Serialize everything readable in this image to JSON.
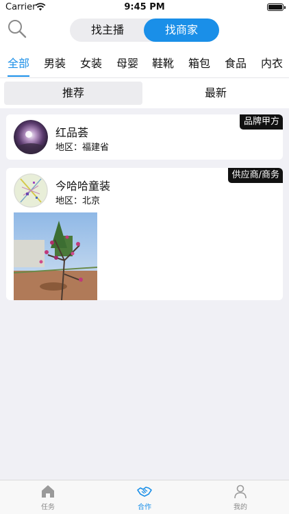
{
  "status_bar": {
    "carrier": "Carrier",
    "time": "9:45 PM"
  },
  "header": {
    "search_icon": "search-icon",
    "toggle": {
      "option_a": "找主播",
      "option_b": "找商家",
      "selected": "找商家"
    }
  },
  "categories": {
    "items": [
      "全部",
      "男装",
      "女装",
      "母婴",
      "鞋靴",
      "箱包",
      "食品",
      "内衣"
    ],
    "active": "全部"
  },
  "sort": {
    "options": [
      "推荐",
      "最新"
    ],
    "selected": "推荐"
  },
  "merchants": [
    {
      "name": "红品荟",
      "region": "地区：福建省",
      "tag": "品牌甲方"
    },
    {
      "name": "今哈哈童装",
      "region": "地区：北京",
      "tag": "供应商/商务"
    }
  ],
  "tabbar": {
    "items": [
      {
        "label": "任务",
        "icon": "home-icon"
      },
      {
        "label": "合作",
        "icon": "handshake-icon"
      },
      {
        "label": "我的",
        "icon": "user-icon"
      }
    ],
    "active": "合作"
  },
  "colors": {
    "accent": "#1a8fe8",
    "tag_bg": "#111111",
    "page_bg": "#f0f0f5"
  }
}
